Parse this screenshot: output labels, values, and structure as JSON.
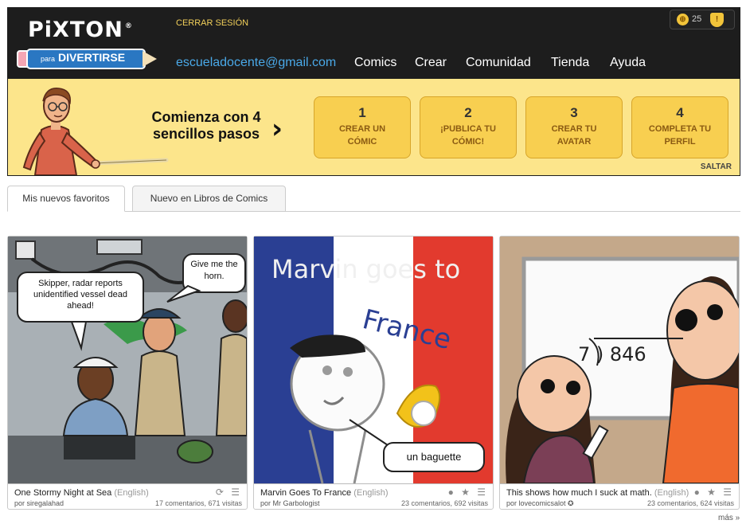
{
  "header": {
    "logo_text": "PiXTON",
    "logo_reg": "®",
    "pencil_small": "para",
    "pencil_text": "DIVERTIRSE",
    "logout": "CERRAR SESIÓN",
    "email": "escueladocente@gmail.com",
    "nav": [
      "Comics",
      "Crear",
      "Comunidad",
      "Tienda",
      "Ayuda"
    ],
    "coins": "25",
    "coin_icon_glyph": "⊕",
    "shield_glyph": "!"
  },
  "banner": {
    "title": "Comienza con 4 sencillos pasos",
    "arrow": "›",
    "steps": [
      {
        "num": "1",
        "label": "CREAR UN CÓMIC"
      },
      {
        "num": "2",
        "label": "¡PUBLICA TU CÓMIC!"
      },
      {
        "num": "3",
        "label": "CREAR TU AVATAR"
      },
      {
        "num": "4",
        "label": "COMPLETA TU PERFIL"
      }
    ],
    "skip": "SALTAR"
  },
  "tabs": [
    "Mis nuevos favoritos",
    "Nuevo en Libros de Comics"
  ],
  "comics": [
    {
      "bubble1": "Skipper, radar reports unidentified vessel dead ahead!",
      "bubble2": "Give me the horn.",
      "title": "One Stormy Night at Sea",
      "lang": "(English)",
      "by": "por siregalahad",
      "stats": "17 comentarios, 671 visitas",
      "icons": "⟳ ☰"
    },
    {
      "headline1": "Marvin goes to",
      "headline2": "France",
      "bubble": "un baguette",
      "title": "Marvin Goes To France",
      "lang": "(English)",
      "by": "por Mr Garbologist",
      "stats": "23 comentarios, 692 visitas",
      "icons": "● ★ ☰"
    },
    {
      "board": "7 ) 846",
      "title": "This shows how much I suck at math.",
      "lang": "(English)",
      "by": "por lovecomicsalot ✪",
      "stats": "23 comentarios, 624 visitas",
      "icons": "● ★ ☰"
    }
  ],
  "more": "más »"
}
